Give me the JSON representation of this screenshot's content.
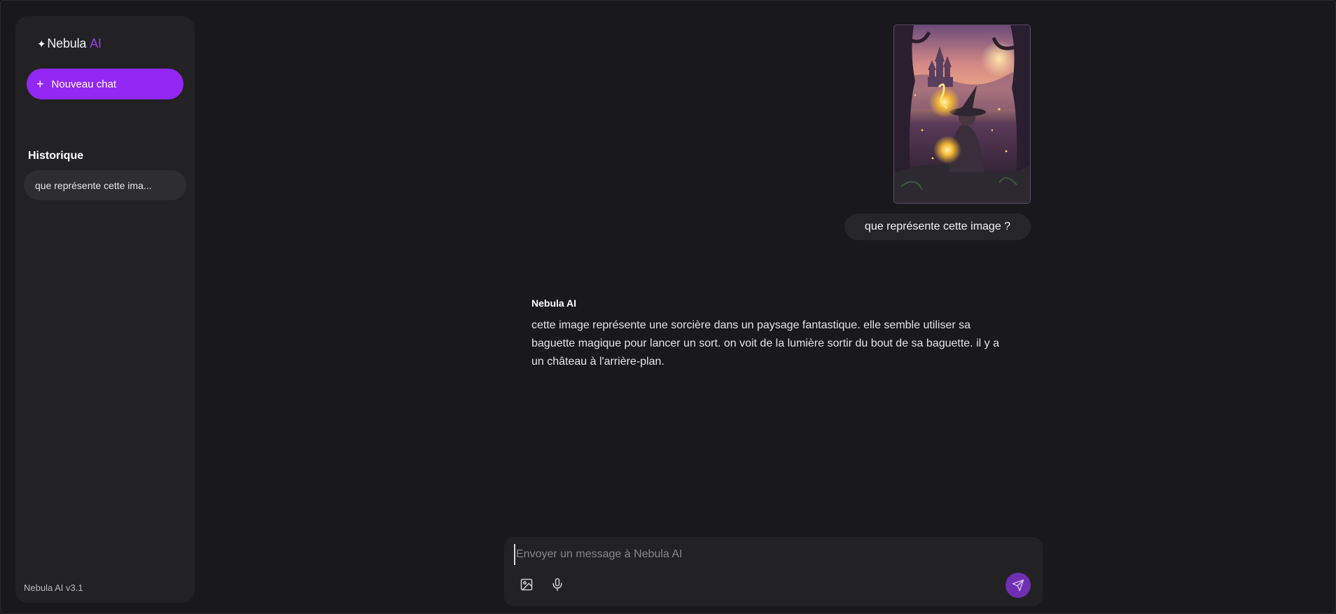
{
  "sidebar": {
    "brand_name": "Nebula",
    "brand_suffix": "AI",
    "brand_icon": "sparkle-icon",
    "new_chat_label": "Nouveau chat",
    "history_title": "Historique",
    "history_items": [
      {
        "label": "que représente cette ima..."
      }
    ],
    "version": "Nebula AI v3.1"
  },
  "chat": {
    "user_message": "que représente cette image ?",
    "user_image_alt": "Sorcière avec une baguette lumineuse devant un château",
    "bot_name": "Nebula AI",
    "bot_message": "cette image représente une sorcière dans un paysage fantastique. elle semble utiliser sa baguette magique pour lancer un sort. on voit de la lumière sortir du bout de sa baguette. il y a un château à l'arrière-plan."
  },
  "composer": {
    "placeholder": "Envoyer un message à Nebula AI",
    "value": "",
    "icons": [
      "image-icon",
      "microphone-icon",
      "send-icon"
    ]
  },
  "colors": {
    "accent": "#9328f4",
    "background": "#19191b",
    "sidebar": "#222225",
    "send_button": "#6f2fb3"
  }
}
